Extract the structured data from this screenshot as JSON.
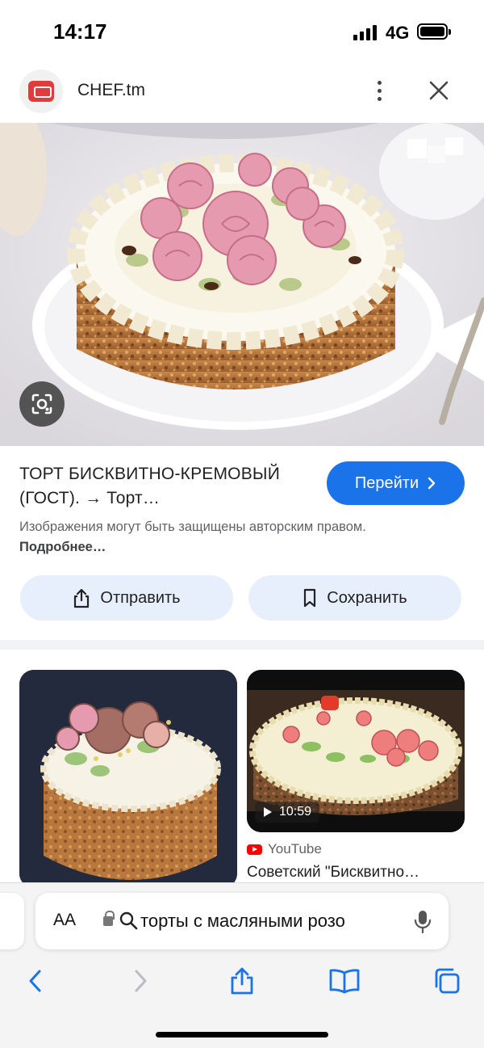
{
  "status_bar": {
    "time": "14:17",
    "network": "4G",
    "battery_level": 1.0
  },
  "source": {
    "name": "CHEF.tm"
  },
  "result": {
    "title": "ТОРТ БИСКВИТНО-КРЕМОВЫЙ (ГОСТ). → Торт…",
    "visit_button": "Перейти",
    "notice": "Изображения могут быть защищены авторским правом.",
    "notice_link": "Подробнее…",
    "share_button": "Отправить",
    "save_button": "Сохранить"
  },
  "related": {
    "video_duration": "10:59",
    "video_source": "YouTube",
    "video_title": "Советский \"Бисквитно…"
  },
  "browser": {
    "text_size_label": "AA",
    "address_query": "торты с масляными розо"
  },
  "colors": {
    "accent": "#1a73e8",
    "pill": "#e8effc",
    "youtube": "#ff0000"
  },
  "icons": [
    "chef-logo-icon",
    "more-vert-icon",
    "close-icon",
    "lens-icon",
    "share-icon",
    "bookmark-icon",
    "play-icon",
    "youtube-icon",
    "lock-icon",
    "search-icon",
    "mic-icon",
    "back-icon",
    "forward-icon",
    "share-sheet-icon",
    "bookmarks-icon",
    "tabs-icon"
  ]
}
